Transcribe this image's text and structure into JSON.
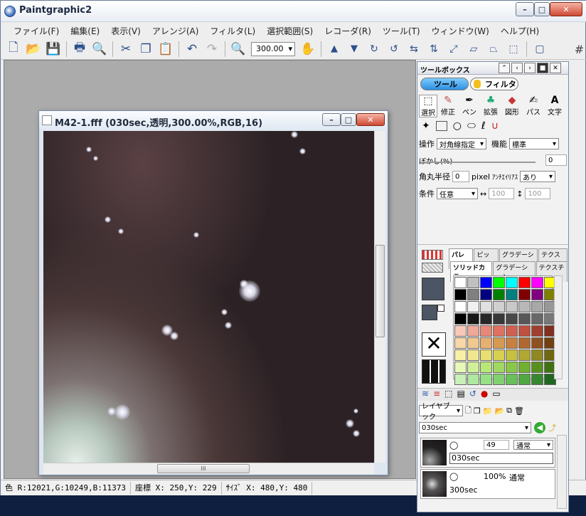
{
  "app": {
    "title": "Paintgraphic2"
  },
  "menu": [
    "ファイル(F)",
    "編集(E)",
    "表示(V)",
    "アレンジ(A)",
    "フィルタ(L)",
    "選択範囲(S)",
    "レコーダ(R)",
    "ツール(T)",
    "ウィンドウ(W)",
    "ヘルプ(H)"
  ],
  "toolbar": {
    "zoom_value": "300.00",
    "icons": [
      "new-file-icon",
      "open-folder-icon",
      "save-icon",
      "print-icon",
      "print-preview-icon",
      "cut-icon",
      "copy-icon",
      "paste-icon",
      "undo-icon",
      "redo-icon",
      "zoom-icon",
      "hand-icon",
      "move-up-icon",
      "move-down-icon",
      "rotate-cw-icon",
      "rotate-ccw-icon",
      "flip-h-icon",
      "flip-v-icon",
      "stretch-icon",
      "skew-icon",
      "perspective-icon",
      "transform-icon",
      "select-all-icon",
      "grid-icon"
    ]
  },
  "document": {
    "title": "M42-1.fff (030sec,透明,300.00%,RGB,16)",
    "scroll_grip": "III"
  },
  "status": {
    "color": "色 R:12021,G:10249,B:11373",
    "coord": "座標 X: 250,Y: 229",
    "size": "ｻｲｽﾞ X: 480,Y: 480"
  },
  "toolbox": {
    "title": "ツールボックス",
    "tab_tool": "ツール",
    "tab_filter": "フィルタ",
    "categories": [
      "選択",
      "修正",
      "ペン",
      "拡張",
      "図形",
      "パス",
      "文字"
    ],
    "op_label": "操作",
    "op_value": "対角線指定",
    "func_label": "機能",
    "func_value": "標準",
    "blur_label": "ぼかし(%)",
    "blur_value": "0",
    "radius_label": "角丸半径",
    "radius_value": "0",
    "radius_unit": "pixel",
    "antialias_label": "ｱﾝﾁｴｲﾘｱｽ",
    "antialias_value": "あり",
    "cond_label": "条件",
    "cond_value": "任意",
    "w_value": "100",
    "h_value": "100",
    "palette_tabs": [
      "パレット",
      "ピッカー",
      "グラデーション",
      "テクスチャ"
    ],
    "palette_subtabs": [
      "ソリッドカラー",
      "グラデーション",
      "テクスチャ"
    ],
    "layer_mode": "レイヤブック",
    "layer_current": "030sec",
    "layers": [
      {
        "name": "030sec",
        "opacity": "49",
        "blend": "通常"
      },
      {
        "name": "300sec",
        "opacity": "100%",
        "blend": "通常"
      }
    ]
  },
  "colors": {
    "palette": [
      "#ffffff",
      "#c0c0c0",
      "#0000ff",
      "#00ff00",
      "#00ffff",
      "#ff0000",
      "#ff00ff",
      "#ffff00",
      "#000000",
      "#808080",
      "#000080",
      "#008000",
      "#008080",
      "#800000",
      "#800080",
      "#808000",
      "#ffffff",
      "#f0f0f0",
      "#e0e0e0",
      "#d0d0d0",
      "#c8c8c8",
      "#b8b8b8",
      "#a8a8a8",
      "#989898",
      "#000000",
      "#181818",
      "#282828",
      "#383838",
      "#484848",
      "#585858",
      "#686868",
      "#787878",
      "#f7c8b8",
      "#f0a898",
      "#e88878",
      "#e07060",
      "#d06050",
      "#c05040",
      "#a04030",
      "#803020",
      "#f7d8a8",
      "#f0c890",
      "#e8b070",
      "#d89850",
      "#c88040",
      "#b06830",
      "#905020",
      "#704010",
      "#f8f0a8",
      "#f0e890",
      "#e8e070",
      "#d8d050",
      "#c8c040",
      "#b0a830",
      "#908820",
      "#706810",
      "#e8f8b8",
      "#d0f098",
      "#b8e878",
      "#a0d860",
      "#88c848",
      "#70b030",
      "#589020",
      "#407010",
      "#c8f0b8",
      "#b0e8a0",
      "#98e088",
      "#80d070",
      "#68c058",
      "#50a840",
      "#388830",
      "#206820"
    ]
  }
}
